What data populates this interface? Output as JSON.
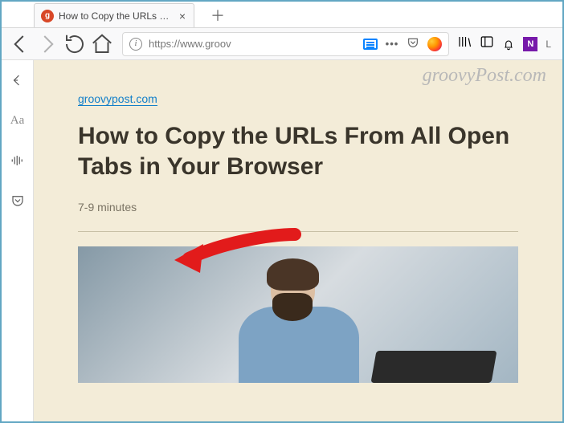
{
  "tab": {
    "favicon_letter": "g",
    "title": "How to Copy the URLs From All Open Tabs in Your Browser"
  },
  "urlbar": {
    "url_display": "https://www.groov",
    "protocol_secure": true
  },
  "toolbar": {
    "user_initial": "L",
    "onenote_letter": "N"
  },
  "article": {
    "domain": "groovypost.com",
    "title": "How to Copy the URLs From All Open Tabs in Your Browser",
    "read_time": "7-9 minutes"
  },
  "watermark": "groovyPost.com"
}
